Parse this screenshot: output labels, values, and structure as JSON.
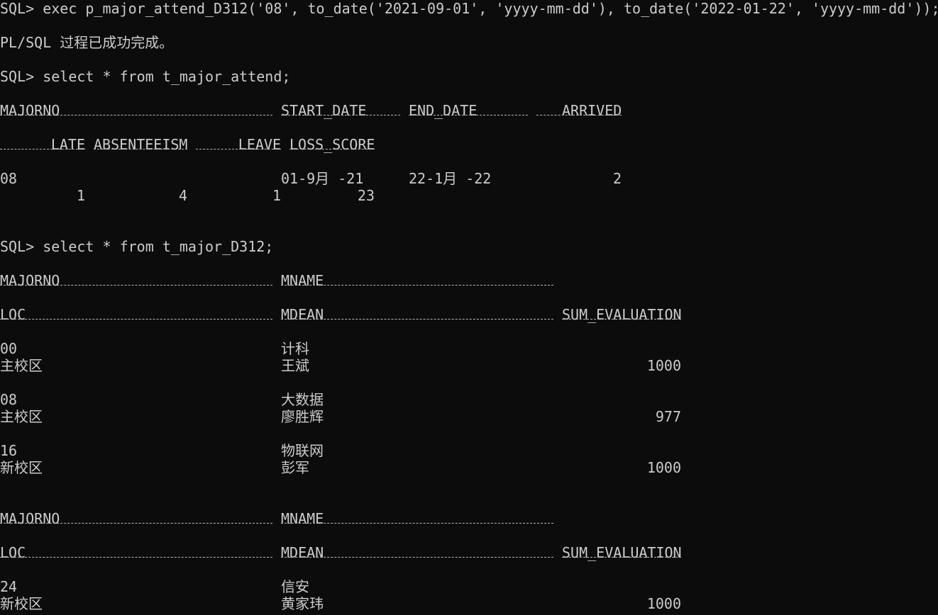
{
  "colors": {
    "background": "#0c0c0c",
    "text": "#cccccc"
  },
  "console": {
    "exec_line": "SQL> exec p_major_attend_D312('08', to_date('2021-09-01', 'yyyy-mm-dd'), to_date('2022-01-22', 'yyyy-mm-dd'));",
    "exec_result": "PL/SQL 过程已成功完成。",
    "query1": "SQL> select * from t_major_attend;",
    "attend": {
      "headers_row1": [
        "MAJORNO",
        "START_DATE",
        "END_DATE",
        "ARRIVED"
      ],
      "headers_row2": [
        "LATE",
        "ABSENTEEISM",
        "LEAVE",
        "LOSS_SCORE"
      ],
      "row": {
        "majorno": "08",
        "start_date": "01-9月 -21",
        "end_date": "22-1月 -22",
        "arrived": "2",
        "late": "1",
        "absenteeism": "4",
        "leave": "1",
        "loss_score": "23"
      }
    },
    "query2": "SQL> select * from t_major_D312;",
    "major": {
      "headers_row1": [
        "MAJORNO",
        "MNAME"
      ],
      "headers_row2": [
        "LOC",
        "MDEAN",
        "SUM_EVALUATION"
      ],
      "records": [
        {
          "majorno": "00",
          "mname": "计科",
          "loc": "主校区",
          "mdean": "王斌",
          "sum_evaluation": "1000"
        },
        {
          "majorno": "08",
          "mname": "大数据",
          "loc": "主校区",
          "mdean": "廖胜辉",
          "sum_evaluation": "977"
        },
        {
          "majorno": "16",
          "mname": "物联网",
          "loc": "新校区",
          "mdean": "彭军",
          "sum_evaluation": "1000"
        },
        {
          "majorno": "24",
          "mname": "信安",
          "loc": "新校区",
          "mdean": "黄家玮",
          "sum_evaluation": "1000"
        }
      ]
    }
  }
}
